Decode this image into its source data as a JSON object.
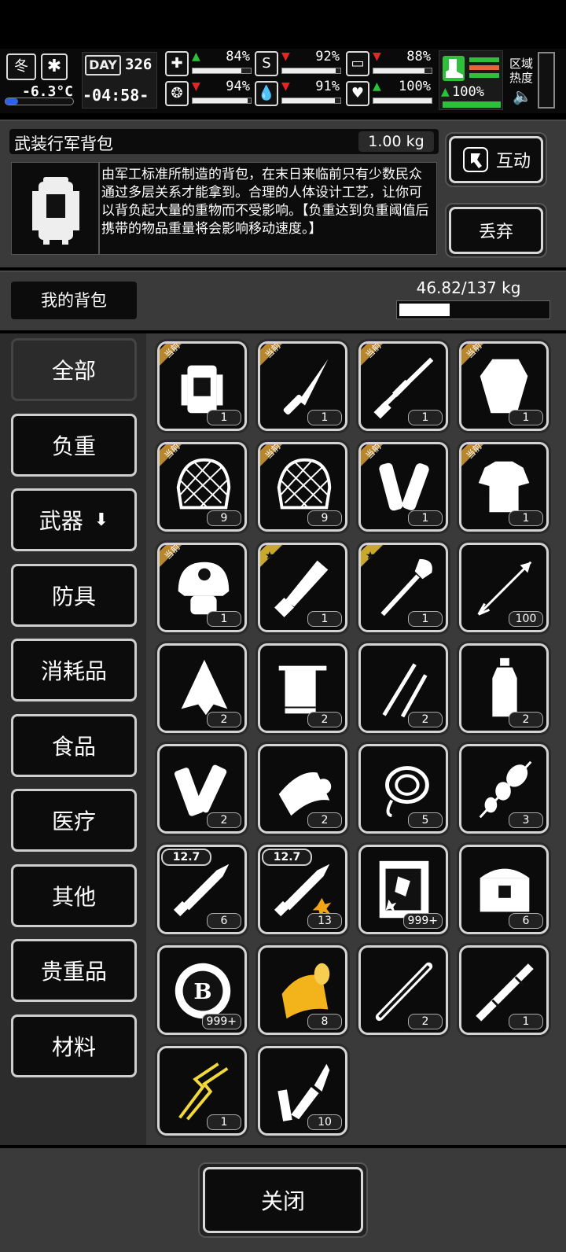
{
  "hud": {
    "season": "冬",
    "temperature": "-6.3°C",
    "day_label": "DAY",
    "day_number": "326",
    "clock": "-04:58-",
    "stats": [
      {
        "icon": "medkit-icon",
        "trend": "up",
        "value": "84%",
        "fill": 0.84
      },
      {
        "icon": "stomach-icon",
        "trend": "down",
        "value": "92%",
        "fill": 0.92
      },
      {
        "icon": "battery-icon",
        "trend": "down",
        "value": "88%",
        "fill": 0.88
      },
      {
        "icon": "brain-icon",
        "trend": "down",
        "value": "94%",
        "fill": 0.94
      },
      {
        "icon": "water-drop-icon",
        "trend": "down",
        "value": "91%",
        "fill": 0.91
      },
      {
        "icon": "heart-icon",
        "trend": "up",
        "value": "100%",
        "fill": 1.0
      }
    ],
    "stamina": {
      "trend": "up",
      "value": "100%",
      "fill": 1.0
    },
    "zone_heat_label": "区域热度",
    "colors": {
      "up": "#29c23b",
      "down": "#e02626",
      "stamina": "#2fbf3a"
    }
  },
  "selected_item": {
    "name": "武装行军背包",
    "weight": "1.00 kg",
    "description": "由军工标准所制造的背包，在末日来临前只有少数民众通过多层关系才能拿到。合理的人体设计工艺，让你可以背负起大量的重物而不受影响。【负重达到负重阈值后携带的物品重量将会影响移动速度。】"
  },
  "actions": {
    "interact": "互动",
    "discard": "丢弃",
    "close": "关闭"
  },
  "inventory": {
    "title": "我的背包",
    "weight": "46.82/137 kg",
    "load_fraction": 0.34
  },
  "categories": [
    "全部",
    "负重",
    "武器",
    "防具",
    "消耗品",
    "食品",
    "医疗",
    "其他",
    "贵重品",
    "材料"
  ],
  "badge_labels": {
    "current": "当前"
  },
  "items": [
    {
      "name": "backpack",
      "count": "1",
      "badge": "current"
    },
    {
      "name": "knife",
      "count": "1",
      "badge": "current"
    },
    {
      "name": "sniper-rifle",
      "count": "1",
      "badge": "current"
    },
    {
      "name": "armor-plate",
      "count": "1",
      "badge": "current"
    },
    {
      "name": "ghillie-net",
      "count": "9",
      "badge": "current"
    },
    {
      "name": "ghillie-net",
      "count": "9",
      "badge": "current"
    },
    {
      "name": "arm-guards",
      "count": "1",
      "badge": "current"
    },
    {
      "name": "body-armor",
      "count": "1",
      "badge": "current"
    },
    {
      "name": "tactical-helmet",
      "count": "1",
      "badge": "current"
    },
    {
      "name": "machete",
      "count": "1",
      "badge": "star"
    },
    {
      "name": "shovel",
      "count": "1",
      "badge": "star"
    },
    {
      "name": "arrow",
      "count": "100",
      "badge": ""
    },
    {
      "name": "torn-cloth",
      "count": "2",
      "badge": ""
    },
    {
      "name": "towel",
      "count": "2",
      "badge": ""
    },
    {
      "name": "tweezers",
      "count": "2",
      "badge": ""
    },
    {
      "name": "water-bottle",
      "count": "2",
      "badge": ""
    },
    {
      "name": "splint",
      "count": "2",
      "badge": ""
    },
    {
      "name": "bandage-roll",
      "count": "2",
      "badge": ""
    },
    {
      "name": "rope",
      "count": "5",
      "badge": ""
    },
    {
      "name": "kebab",
      "count": "3",
      "badge": ""
    },
    {
      "name": "bullet",
      "count": "6",
      "badge": "",
      "caliber": "12.7"
    },
    {
      "name": "explosive-bullet",
      "count": "13",
      "badge": "",
      "caliber": "12.7"
    },
    {
      "name": "stamp-card",
      "count": "999+",
      "badge": ""
    },
    {
      "name": "treasure-chest",
      "count": "6",
      "badge": ""
    },
    {
      "name": "b-coin",
      "count": "999+",
      "badge": ""
    },
    {
      "name": "gold-roll",
      "count": "8",
      "badge": ""
    },
    {
      "name": "pipe",
      "count": "2",
      "badge": ""
    },
    {
      "name": "metal-rod",
      "count": "1",
      "badge": ""
    },
    {
      "name": "gold-wire",
      "count": "1",
      "badge": ""
    },
    {
      "name": "spearhead",
      "count": "10",
      "badge": ""
    }
  ]
}
